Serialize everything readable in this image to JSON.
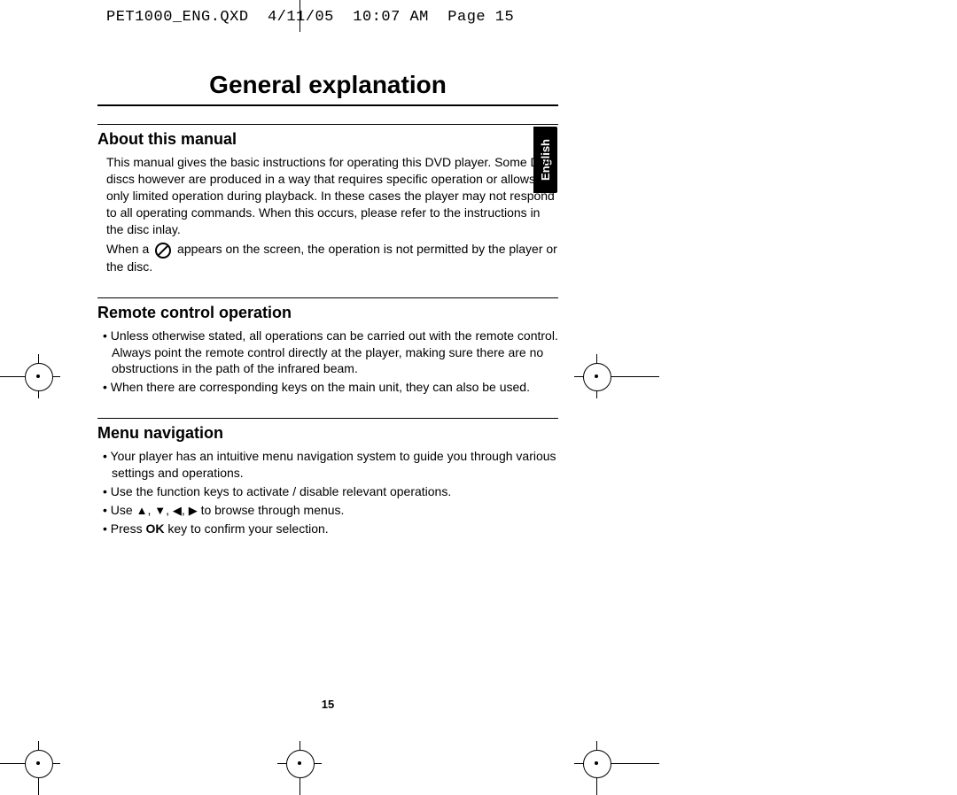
{
  "header": {
    "filename": "PET1000_ENG.QXD",
    "date": "4/11/05",
    "time": "10:07 AM",
    "page_label": "Page 15"
  },
  "lang_tab": "English",
  "page_title": "General explanation",
  "sections": {
    "about": {
      "title": "About this manual",
      "para1": "This manual gives the basic instructions for operating this DVD player. Some DVD discs however are produced in a way that requires specific operation or allows only limited operation during playback. In these cases the player may not respond to all operating commands. When this occurs, please refer to the instructions in the disc inlay.",
      "when_a": "When a",
      "after_icon": "appears on the screen, the operation is not permitted by the player or the disc."
    },
    "remote": {
      "title": "Remote control operation",
      "bullets": [
        "Unless otherwise stated, all operations can be carried out with the remote control. Always point the remote control directly at the player, making sure there are no obstructions in the path of the infrared beam.",
        "When there are corresponding keys on the main unit, they can also be used."
      ]
    },
    "menu": {
      "title": "Menu navigation",
      "bullets": {
        "b1": "Your player has an intuitive menu navigation system to guide you through various settings and operations.",
        "b2": "Use the function keys to activate / disable relevant operations.",
        "b3_pre": "Use ",
        "b3_post": " to browse through menus.",
        "b4_pre": "Press ",
        "b4_bold": "OK",
        "b4_post": " key to confirm your selection."
      }
    }
  },
  "page_number": "15"
}
